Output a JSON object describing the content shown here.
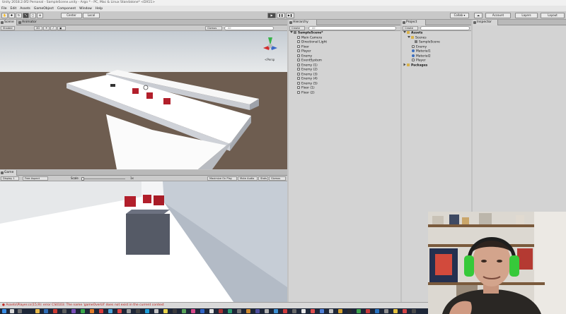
{
  "window": {
    "title": "Unity 2018.2.0f2 Personal - SampleScene.unity - Argo * - PC, Mac & Linux Standalone* <DX11>"
  },
  "menu": [
    "File",
    "Edit",
    "Assets",
    "GameObject",
    "Component",
    "Window",
    "Help"
  ],
  "toolbar": {
    "pivot_label": "Center",
    "space_label": "Local",
    "collab_label": "Collab ▾",
    "account_label": "Account",
    "layers_label": "Layers",
    "layout_label": "Layout"
  },
  "scene_panel": {
    "tabs": [
      "Scene",
      "Animator"
    ],
    "mode_label": "2D",
    "gizmos_label": "Gizmos",
    "search_placeholder": "All",
    "persp_label": "<Persp"
  },
  "game_panel": {
    "tab": "Game",
    "display": "Display 1",
    "aspect": "Free Aspect",
    "scale_label": "Scale",
    "scale_value": "1x",
    "maximize_label": "Maximize On Play",
    "mute_label": "Mute Audio",
    "stats_label": "Stats",
    "gizmos_label": "Gizmos"
  },
  "hierarchy": {
    "tab": "Hierarchy",
    "create_label": "Create",
    "search_placeholder": "All",
    "scene": "SampleScene*",
    "items": [
      "Main Camera",
      "Directional Light",
      "Floor",
      "Player",
      "Enemy",
      "EventSystem",
      "Enemy (1)",
      "Enemy (2)",
      "Enemy (3)",
      "Enemy (4)",
      "Enemy (5)",
      "Floor (1)",
      "Floor (2)"
    ]
  },
  "project": {
    "tab": "Project",
    "create_label": "Create",
    "root": "Assets",
    "folders": [
      "Scenes"
    ],
    "items": [
      "SampleScene",
      "Enemy",
      "Material1",
      "Material2",
      "Player"
    ],
    "packages": "Packages"
  },
  "inspector": {
    "tab": "Inspector"
  },
  "console": {
    "error": "Assets\\Player.cs(15,9): error CS0103: The name 'gameOverUI' does not exist in the current context"
  },
  "colors": {
    "enemy_cube": "#b21f2b",
    "player_cube": "#555a66",
    "error_text": "#c0221b",
    "sky": "#d9dde0",
    "ground": "#6b5a4e",
    "headset": "#37c93a"
  }
}
